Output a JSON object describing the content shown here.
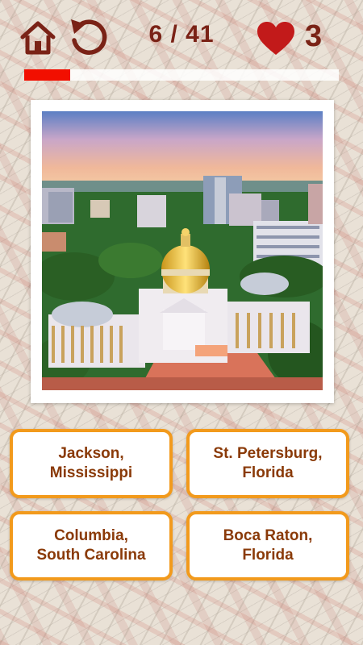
{
  "header": {
    "home_icon": "home-icon",
    "restart_icon": "restart-icon",
    "question_counter": "6 / 41",
    "current_question": 6,
    "total_questions": 41,
    "lives_icon": "heart-icon",
    "lives": "3",
    "progress_fraction": 0.146,
    "colors": {
      "text": "#7a2216",
      "heart": "#c21a1a",
      "progress": "#f20f00"
    }
  },
  "question": {
    "image": "Aerial view of a domed state capitol building amid trees with city skyline at sunset"
  },
  "answers": [
    {
      "label": "Jackson,\nMississippi"
    },
    {
      "label": "St. Petersburg,\nFlorida"
    },
    {
      "label": "Columbia,\nSouth Carolina"
    },
    {
      "label": "Boca Raton,\nFlorida"
    }
  ],
  "colors": {
    "answer_border": "#f29a1c",
    "answer_text": "#8a3a08"
  }
}
